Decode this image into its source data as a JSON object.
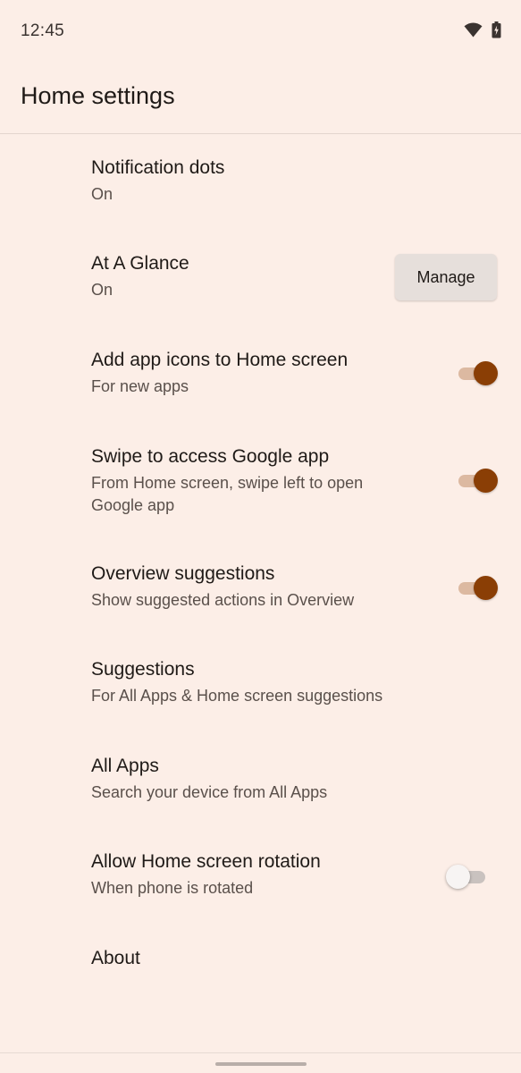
{
  "status_bar": {
    "time": "12:45",
    "icons": [
      "wifi-icon",
      "battery-icon"
    ]
  },
  "app_bar": {
    "title": "Home settings"
  },
  "settings": [
    {
      "title": "Notification dots",
      "summary": "On",
      "control": "none"
    },
    {
      "title": "At A Glance",
      "summary": "On",
      "control": "button",
      "button_label": "Manage"
    },
    {
      "title": "Add app icons to Home screen",
      "summary": "For new apps",
      "control": "switch",
      "checked": true
    },
    {
      "title": "Swipe to access Google app",
      "summary": "From Home screen, swipe left to open Google app",
      "control": "switch",
      "checked": true
    },
    {
      "title": "Overview suggestions",
      "summary": "Show suggested actions in Overview",
      "control": "switch",
      "checked": true
    },
    {
      "title": "Suggestions",
      "summary": "For All Apps & Home screen suggestions",
      "control": "none"
    },
    {
      "title": "All Apps",
      "summary": "Search your device from All Apps",
      "control": "none"
    },
    {
      "title": "Allow Home screen rotation",
      "summary": "When phone is rotated",
      "control": "switch",
      "checked": false
    },
    {
      "title": "About",
      "control": "none"
    }
  ],
  "colors": {
    "background": "#FCEEE7",
    "accent": "#8A3E05",
    "switch_track_on": "#DCB9A1",
    "button_bg": "#E6DFDB"
  }
}
